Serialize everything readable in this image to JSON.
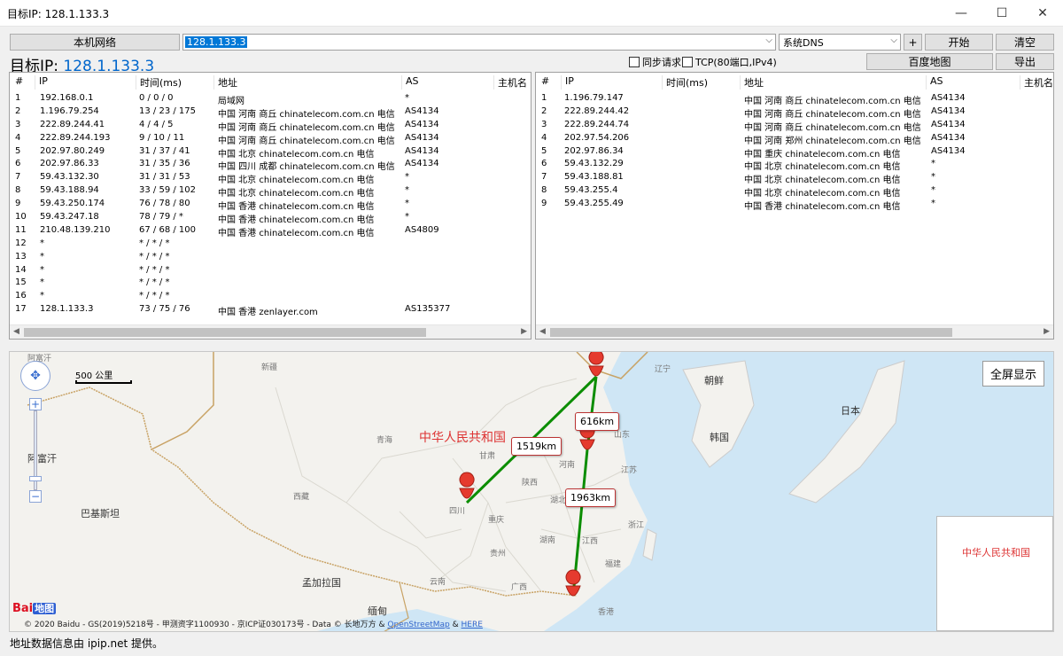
{
  "window": {
    "title": "目标IP: 128.1.133.3"
  },
  "toolbar": {
    "local_network_button": "本机网络",
    "target_input": "128.1.133.3",
    "dns_select": "系统DNS",
    "plus_button": "+",
    "start_button": "开始",
    "clear_button": "清空",
    "baidu_map_button": "百度地图",
    "export_button": "导出",
    "sync_request": "同步请求",
    "tcp_option": "TCP(80端口,IPv4)"
  },
  "target": {
    "label": "目标IP:",
    "ip": "128.1.133.3"
  },
  "left_table": {
    "headers": [
      "#",
      "IP",
      "时间(ms)",
      "地址",
      "AS",
      "主机名"
    ],
    "rows": [
      [
        "1",
        "192.168.0.1",
        "0 / 0 / 0",
        "局域网",
        "*"
      ],
      [
        "2",
        "1.196.79.254",
        "13 / 23 / 175",
        "中国 河南 商丘 chinatelecom.com.cn 电信",
        "AS4134"
      ],
      [
        "3",
        "222.89.244.41",
        "4 / 4 / 5",
        "中国 河南 商丘 chinatelecom.com.cn 电信",
        "AS4134"
      ],
      [
        "4",
        "222.89.244.193",
        "9 / 10 / 11",
        "中国 河南 商丘 chinatelecom.com.cn 电信",
        "AS4134"
      ],
      [
        "5",
        "202.97.80.249",
        "31 / 37 / 41",
        "中国 北京 chinatelecom.com.cn 电信",
        "AS4134"
      ],
      [
        "6",
        "202.97.86.33",
        "31 / 35 / 36",
        "中国 四川 成都 chinatelecom.com.cn 电信",
        "AS4134"
      ],
      [
        "7",
        "59.43.132.30",
        "31 / 31 / 53",
        "中国 北京 chinatelecom.com.cn 电信",
        "*"
      ],
      [
        "8",
        "59.43.188.94",
        "33 / 59 / 102",
        "中国 北京 chinatelecom.com.cn 电信",
        "*"
      ],
      [
        "9",
        "59.43.250.174",
        "76 / 78 / 80",
        "中国 香港 chinatelecom.com.cn 电信",
        "*"
      ],
      [
        "10",
        "59.43.247.18",
        "78 / 79 / *",
        "中国 香港 chinatelecom.com.cn 电信",
        "*"
      ],
      [
        "11",
        "210.48.139.210",
        "67 / 68 / 100",
        "中国 香港 chinatelecom.com.cn 电信",
        "AS4809"
      ],
      [
        "12",
        "*",
        "* / * / *",
        "",
        ""
      ],
      [
        "13",
        "*",
        "* / * / *",
        "",
        ""
      ],
      [
        "14",
        "*",
        "* / * / *",
        "",
        ""
      ],
      [
        "15",
        "*",
        "* / * / *",
        "",
        ""
      ],
      [
        "16",
        "*",
        "* / * / *",
        "",
        ""
      ],
      [
        "17",
        "128.1.133.3",
        "73 / 75 / 76",
        "中国 香港 zenlayer.com",
        "AS135377"
      ]
    ]
  },
  "right_table": {
    "headers": [
      "#",
      "IP",
      "时间(ms)",
      "地址",
      "AS",
      "主机名"
    ],
    "rows": [
      [
        "1",
        "1.196.79.147",
        "",
        "中国 河南 商丘 chinatelecom.com.cn 电信",
        "AS4134"
      ],
      [
        "2",
        "222.89.244.42",
        "",
        "中国 河南 商丘 chinatelecom.com.cn 电信",
        "AS4134"
      ],
      [
        "3",
        "222.89.244.74",
        "",
        "中国 河南 商丘 chinatelecom.com.cn 电信",
        "AS4134"
      ],
      [
        "4",
        "202.97.54.206",
        "",
        "中国 河南 郑州 chinatelecom.com.cn 电信",
        "AS4134"
      ],
      [
        "5",
        "202.97.86.34",
        "",
        "中国 重庆 chinatelecom.com.cn 电信",
        "AS4134"
      ],
      [
        "6",
        "59.43.132.29",
        "",
        "中国 北京 chinatelecom.com.cn 电信",
        "*"
      ],
      [
        "7",
        "59.43.188.81",
        "",
        "中国 北京 chinatelecom.com.cn 电信",
        "*"
      ],
      [
        "8",
        "59.43.255.4",
        "",
        "中国 北京 chinatelecom.com.cn 电信",
        "*"
      ],
      [
        "9",
        "59.43.255.49",
        "",
        "中国 香港 chinatelecom.com.cn 电信",
        "*"
      ]
    ]
  },
  "map": {
    "fullscreen_button": "全屏显示",
    "scale": "500 公里",
    "china_label": "中华人民共和国",
    "inset_label": "中华人民共和国",
    "distances": {
      "d1": "1519km",
      "d2": "616km",
      "d3": "1963km"
    },
    "countries": {
      "korea_north": "朝鲜",
      "korea_south": "韩国",
      "japan": "日本",
      "afghanistan": "阿富汗",
      "pakistan": "巴基斯坦",
      "bangladesh": "孟加拉国",
      "myanmar": "缅甸"
    },
    "regions": {
      "xinjiang": "新疆",
      "qinghai": "青海",
      "gansu": "甘肃",
      "tibet": "西藏",
      "sichuan": "四川",
      "chongqing": "重庆",
      "hubei": "湖北",
      "hunan": "湖南",
      "guizhou": "贵州",
      "yunnan": "云南",
      "guangxi": "广西",
      "jiangxi": "江西",
      "fujian": "福建",
      "zhejiang": "浙江",
      "jiangsu": "江苏",
      "shandong": "山东",
      "liaoning": "辽宁",
      "hongkong": "香港",
      "henan": "河南",
      "shaanxi": "陕西"
    },
    "copyright_prefix": "© 2020 Baidu - GS(2019)5218号 - 甲测资字1100930 - 京ICP证030173号 - Data © 长地万方 & ",
    "osm_link": "OpenStreetMap",
    "amp": " & ",
    "here_link": "HERE",
    "baidu_logo": "Bai",
    "baidu_logo_tag": "地图"
  },
  "status": {
    "text": "地址数据信息由 ipip.net 提供。"
  }
}
